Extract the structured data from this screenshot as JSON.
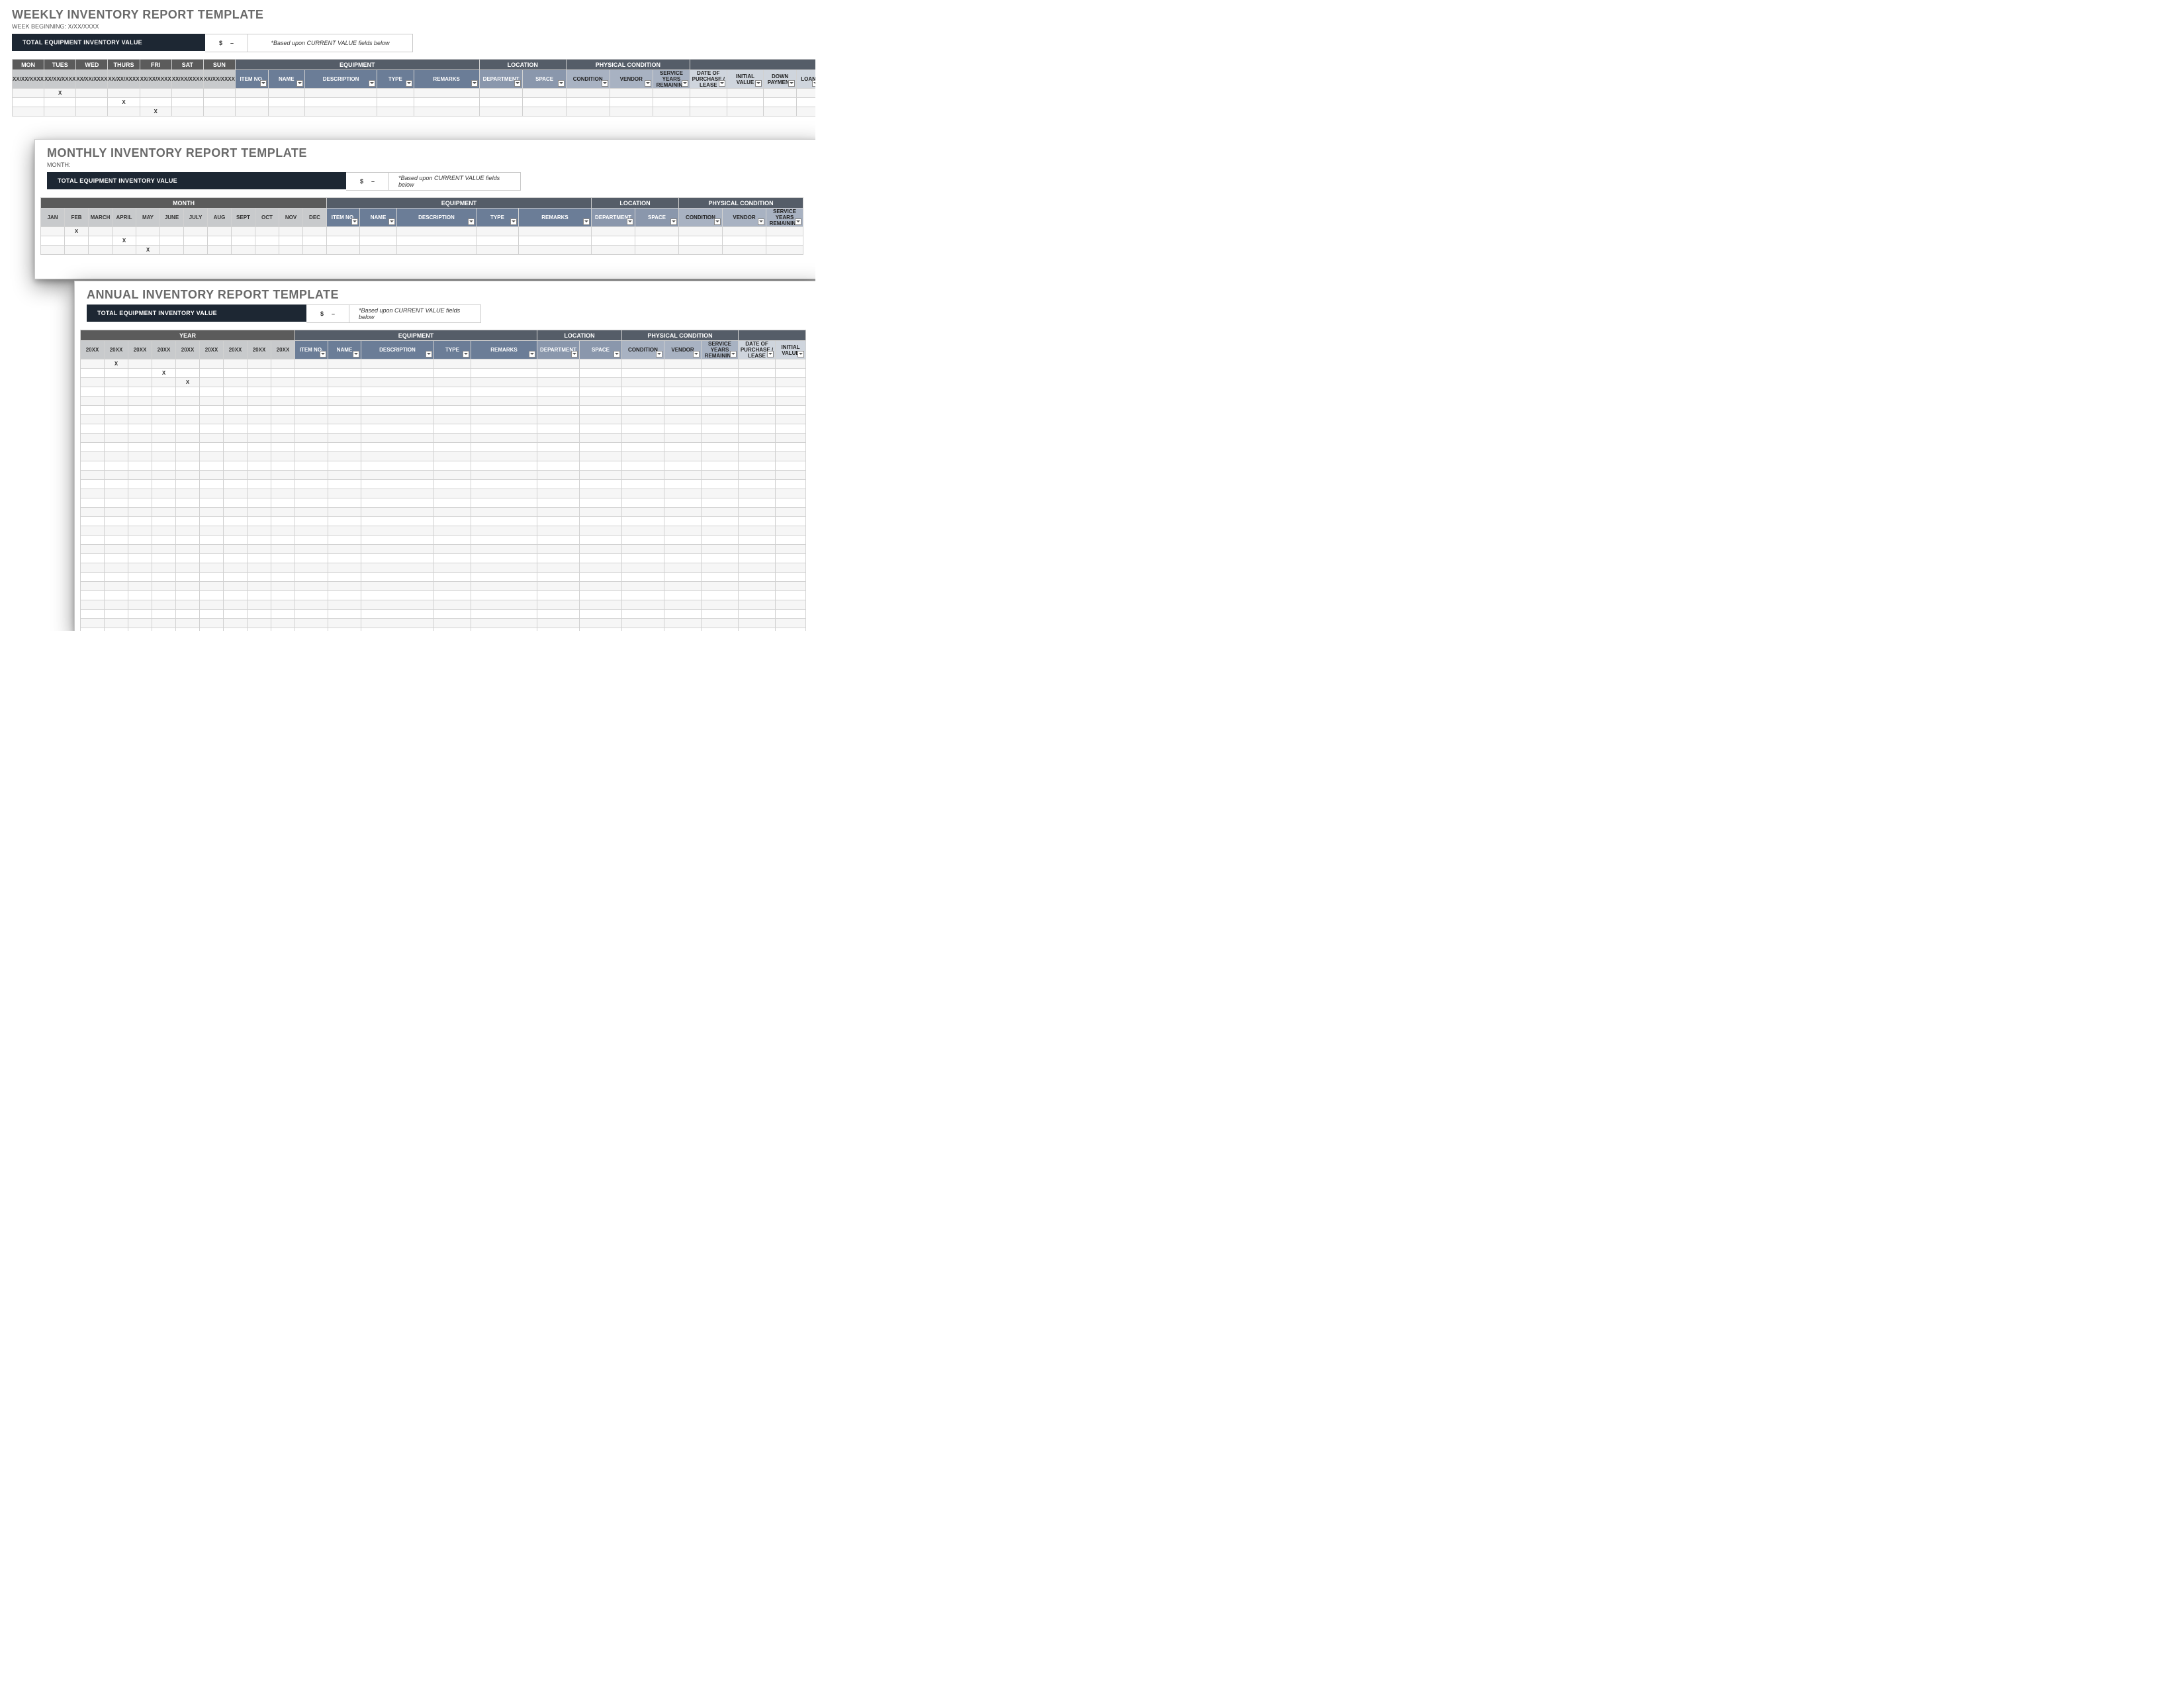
{
  "weekly": {
    "title": "WEEKLY INVENTORY REPORT TEMPLATE",
    "subLabel": "WEEK BEGINNING:",
    "subValue": "X/XX/XXXX",
    "totalLabel": "TOTAL EQUIPMENT INVENTORY VALUE",
    "totalCur": "$",
    "totalVal": "–",
    "note": "*Based upon CURRENT VALUE fields below",
    "days": [
      "MON",
      "TUES",
      "WED",
      "THURS",
      "FRI",
      "SAT",
      "SUN"
    ],
    "dayDates": [
      "XX/XX/XXXX",
      "XX/XX/XXXX",
      "XX/XX/XXXX",
      "XX/XX/XXXX",
      "XX/XX/XXXX",
      "XX/XX/XXXX",
      "XX/XX/XXXX"
    ],
    "groups": [
      "EQUIPMENT",
      "LOCATION",
      "PHYSICAL CONDITION",
      ""
    ],
    "equipCols": [
      "ITEM NO.",
      "NAME",
      "DESCRIPTION",
      "TYPE",
      "REMARKS"
    ],
    "locCols": [
      "DEPARTMENT",
      "SPACE"
    ],
    "condCols": [
      "CONDITION",
      "VENDOR",
      "SERVICE YEARS REMAINING"
    ],
    "otherCols": [
      "DATE OF PURCHASE / LEASE",
      "INITIAL VALUE",
      "DOWN PAYMENT",
      "LOAN"
    ],
    "rows": 3,
    "marks": [
      [
        0,
        1
      ],
      [
        1,
        3
      ],
      [
        2,
        4
      ]
    ]
  },
  "monthly": {
    "title": "MONTHLY INVENTORY REPORT TEMPLATE",
    "subLabel": "MONTH:",
    "totalLabel": "TOTAL EQUIPMENT INVENTORY VALUE",
    "totalCur": "$",
    "totalVal": "–",
    "note": "*Based upon CURRENT VALUE fields below",
    "monthGroup": "MONTH",
    "months": [
      "JAN",
      "FEB",
      "MARCH",
      "APRIL",
      "MAY",
      "JUNE",
      "JULY",
      "AUG",
      "SEPT",
      "OCT",
      "NOV",
      "DEC"
    ],
    "groups": [
      "EQUIPMENT",
      "LOCATION",
      "PHYSICAL CONDITION"
    ],
    "equipCols": [
      "ITEM NO.",
      "NAME",
      "DESCRIPTION",
      "TYPE",
      "REMARKS"
    ],
    "locCols": [
      "DEPARTMENT",
      "SPACE"
    ],
    "condCols": [
      "CONDITION",
      "VENDOR",
      "SERVICE YEARS REMAINING"
    ],
    "rows": 3,
    "marks": [
      [
        0,
        1
      ],
      [
        1,
        3
      ],
      [
        2,
        4
      ]
    ]
  },
  "annual": {
    "title": "ANNUAL INVENTORY REPORT TEMPLATE",
    "totalLabel": "TOTAL EQUIPMENT INVENTORY VALUE",
    "totalCur": "$",
    "totalVal": "–",
    "note": "*Based upon CURRENT VALUE fields below",
    "yearGroup": "YEAR",
    "years": [
      "20XX",
      "20XX",
      "20XX",
      "20XX",
      "20XX",
      "20XX",
      "20XX",
      "20XX",
      "20XX"
    ],
    "groups": [
      "EQUIPMENT",
      "LOCATION",
      "PHYSICAL CONDITION",
      ""
    ],
    "equipCols": [
      "ITEM NO.",
      "NAME",
      "DESCRIPTION",
      "TYPE",
      "REMARKS"
    ],
    "locCols": [
      "DEPARTMENT",
      "SPACE"
    ],
    "condCols": [
      "CONDITION",
      "VENDOR",
      "SERVICE YEARS REMAINING"
    ],
    "otherCols": [
      "DATE OF PURCHASE / LEASE",
      "INITIAL VALUE"
    ],
    "rows": 30,
    "marks": [
      [
        0,
        1
      ],
      [
        1,
        3
      ],
      [
        2,
        4
      ]
    ]
  }
}
